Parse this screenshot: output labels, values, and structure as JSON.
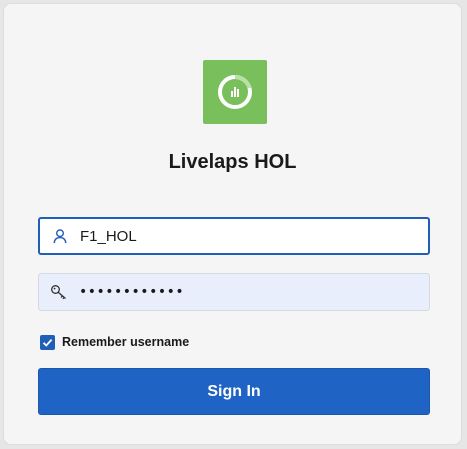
{
  "app": {
    "title": "Livelaps HOL",
    "logo_icon": "app-chart-ring-icon",
    "logo_color": "#79bf5c"
  },
  "form": {
    "username": {
      "value": "F1_HOL",
      "icon": "user-icon"
    },
    "password": {
      "value": "••••••••••••",
      "icon": "key-icon"
    },
    "remember": {
      "label": "Remember username",
      "checked": true
    },
    "submit_label": "Sign In"
  },
  "colors": {
    "accent": "#1f64c4",
    "focus_border": "#1f5fb8",
    "password_bg": "#e8eefb"
  }
}
